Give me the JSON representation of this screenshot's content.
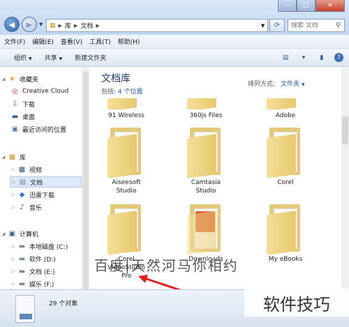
{
  "address": {
    "crumbs": [
      "库",
      "文档"
    ],
    "search_placeholder": "搜索 文档"
  },
  "menu": [
    "文件(F)",
    "编辑(E)",
    "查看(V)",
    "工具(T)",
    "帮助(H)"
  ],
  "commands": {
    "organize": "组织",
    "share": "共享",
    "new_folder": "新建文件夹"
  },
  "sidebar": {
    "favorites": "收藏夹",
    "favorite_items": [
      "Creative Cloud",
      "下载",
      "桌面",
      "最近访问的位置"
    ],
    "libraries": "库",
    "library_items": [
      "视频",
      "文档",
      "迅雷下载",
      "音乐"
    ],
    "computer": "计算机",
    "drives": [
      "本地磁盘 (C:)",
      "软件 (D:)",
      "文档 (E:)",
      "娱乐 (F:)"
    ]
  },
  "library": {
    "title": "文档库",
    "includes_label": "包括:",
    "includes_value": "4 个位置",
    "arrange_label": "排列方式:",
    "arrange_value": "文件夹"
  },
  "folders_row1": [
    "91 Wireless",
    "360js Files",
    "Adobe"
  ],
  "folders_row2": [
    {
      "line1": "Aiseesoft",
      "line2": "Studio"
    },
    {
      "line1": "Camtasia",
      "line2": "Studio"
    },
    {
      "line1": "Corel",
      "line2": ""
    }
  ],
  "folders_row3": [
    {
      "line1": "Corel",
      "line2": "VideoStudio",
      "line3": "Pro"
    },
    {
      "line1": "Downloads",
      "line2": "",
      "line3": ""
    },
    {
      "line1": "My eBooks",
      "line2": "",
      "line3": ""
    }
  ],
  "status": {
    "count": "29 个对象"
  },
  "watermark": {
    "main": "百度|天然河马你相约",
    "corner": "软件技巧"
  }
}
